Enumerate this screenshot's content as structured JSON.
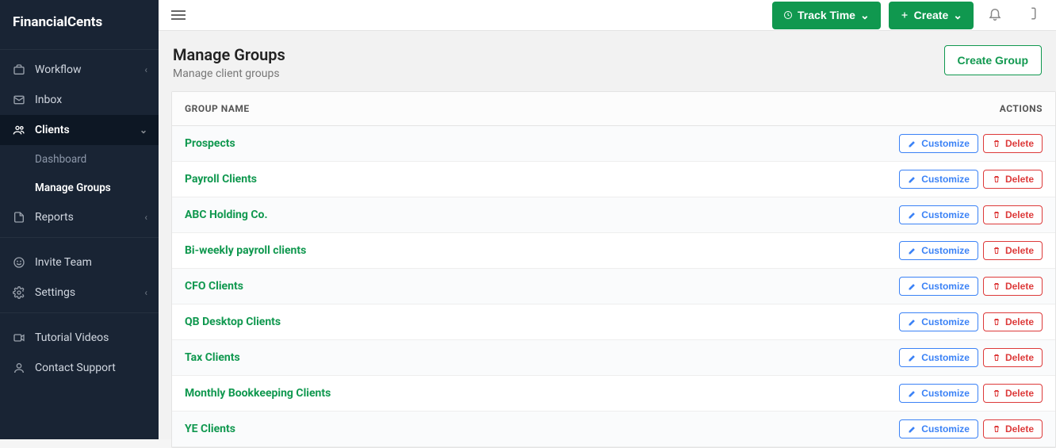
{
  "brand": "FinancialCents",
  "sidebar": {
    "workflow": "Workflow",
    "inbox": "Inbox",
    "clients": "Clients",
    "dashboard": "Dashboard",
    "manage_groups": "Manage Groups",
    "reports": "Reports",
    "invite_team": "Invite Team",
    "settings": "Settings",
    "tutorial_videos": "Tutorial Videos",
    "contact_support": "Contact Support"
  },
  "topbar": {
    "track_time": "Track Time",
    "create": "Create"
  },
  "page": {
    "title": "Manage Groups",
    "subtitle": "Manage client groups",
    "create_group": "Create Group"
  },
  "table": {
    "header_name": "GROUP NAME",
    "header_actions": "ACTIONS",
    "customize_label": "Customize",
    "delete_label": "Delete",
    "rows": [
      {
        "name": "Prospects"
      },
      {
        "name": "Payroll Clients"
      },
      {
        "name": "ABC Holding Co."
      },
      {
        "name": "Bi-weekly payroll clients"
      },
      {
        "name": "CFO Clients"
      },
      {
        "name": "QB Desktop Clients"
      },
      {
        "name": "Tax Clients"
      },
      {
        "name": "Monthly Bookkeeping Clients"
      },
      {
        "name": "YE Clients"
      }
    ]
  }
}
